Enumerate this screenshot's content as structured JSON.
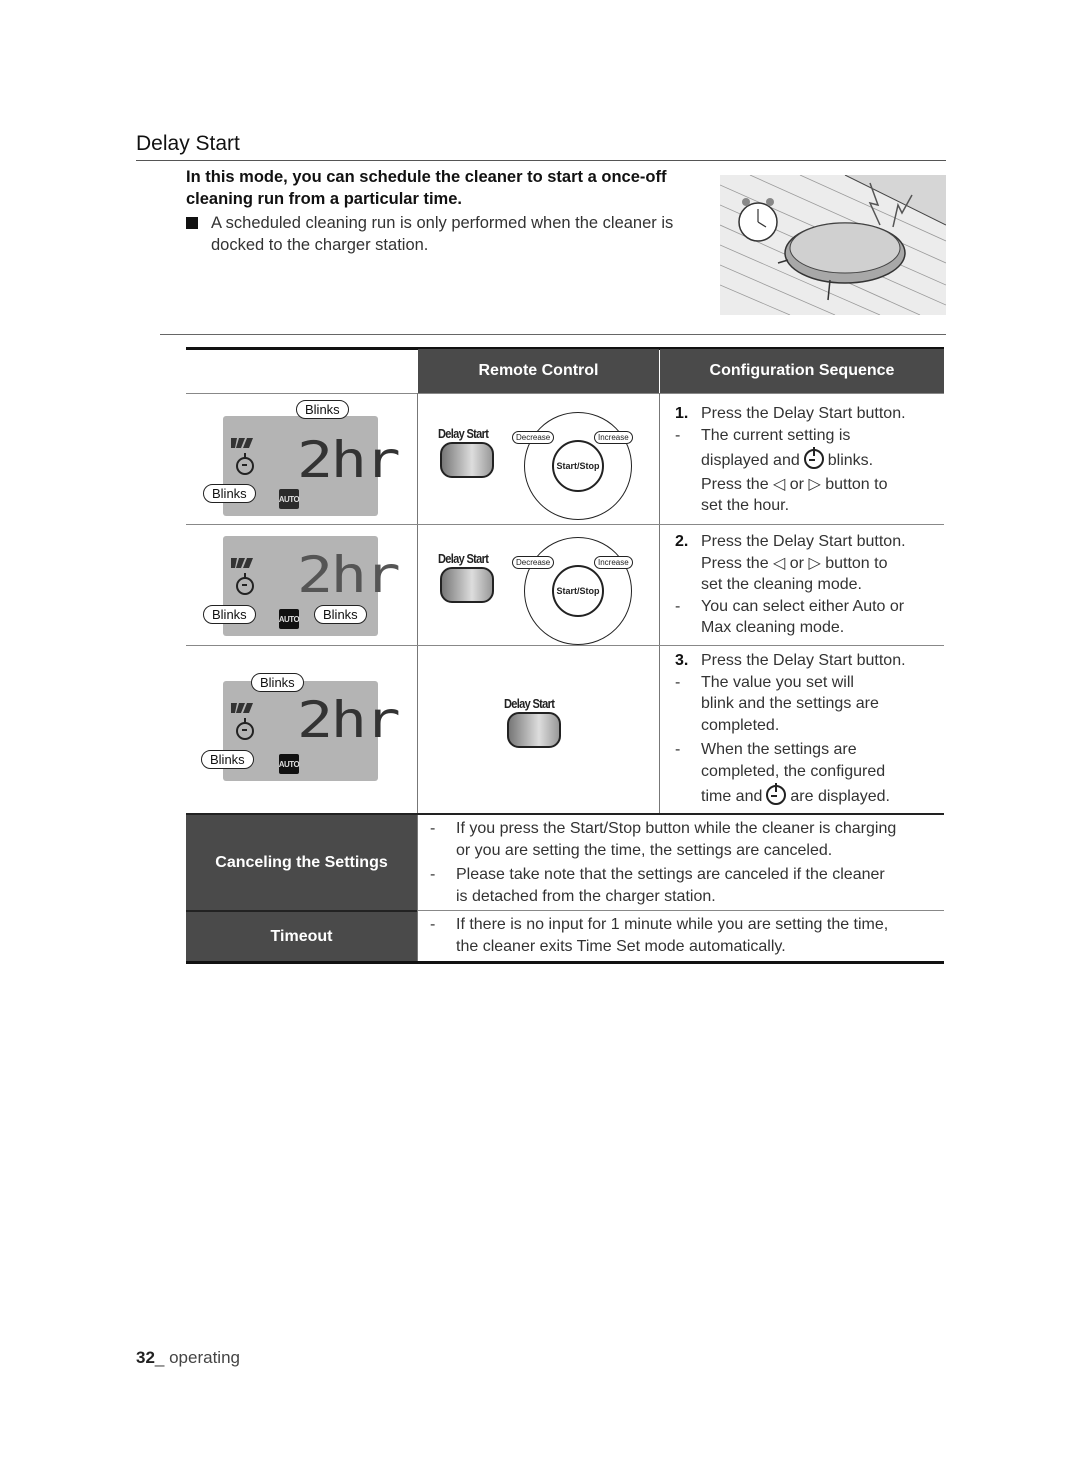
{
  "page": {
    "title": "Delay Start",
    "intro": "In this mode, you can schedule the cleaner to start a once-off cleaning run from a particular time.",
    "note": "A scheduled cleaning run is only performed when the cleaner is docked to the charger station.",
    "illustration": "robot-cleaner-with-alarm-clock"
  },
  "table": {
    "headers": {
      "col1": "",
      "col2": "Remote Control",
      "col3": "Configuration Sequence"
    },
    "lcd": {
      "digits": "2hr",
      "blinks": "Blinks",
      "auto": "AUTO"
    },
    "remote": {
      "delay_start": "Delay Start",
      "decrease": "Decrease",
      "increase": "Increase",
      "start_stop_1": "Start/",
      "start_stop_2": "Stop"
    },
    "steps": [
      {
        "num": "1.",
        "l1": "Press the Delay Start button.",
        "l2": "The current setting is",
        "l3a": "displayed and",
        "l3b": "blinks.",
        "l4": "Press the ◁ or ▷ button to",
        "l5": "set the hour."
      },
      {
        "num": "2.",
        "l1": "Press the Delay Start button.",
        "l2": "Press the ◁ or ▷ button to",
        "l3": "set the cleaning mode.",
        "l4": "You can select either Auto or",
        "l5": "Max cleaning mode."
      },
      {
        "num": "3.",
        "l1": "Press the Delay Start button.",
        "l2": "The value you set will",
        "l3": "blink and the settings are",
        "l4": "completed.",
        "l5": "When the settings are",
        "l6": "completed, the configured",
        "l7a": "time and",
        "l7b": "are displayed."
      }
    ],
    "canceling": {
      "label": "Canceling the Settings",
      "b1l1": "If you press the Start/Stop button while the cleaner is charging",
      "b1l2": "or you are setting the time, the settings are canceled.",
      "b2l1": "Please take note that the settings are canceled if the cleaner",
      "b2l2": "is detached from the charger station."
    },
    "timeout": {
      "label": "Timeout",
      "b1l1": "If there is no input for 1 minute while you are setting the time,",
      "b1l2": "the cleaner exits Time Set mode automatically."
    },
    "dash": "-"
  },
  "footer": {
    "page_num": "32",
    "section": "_ operating"
  }
}
